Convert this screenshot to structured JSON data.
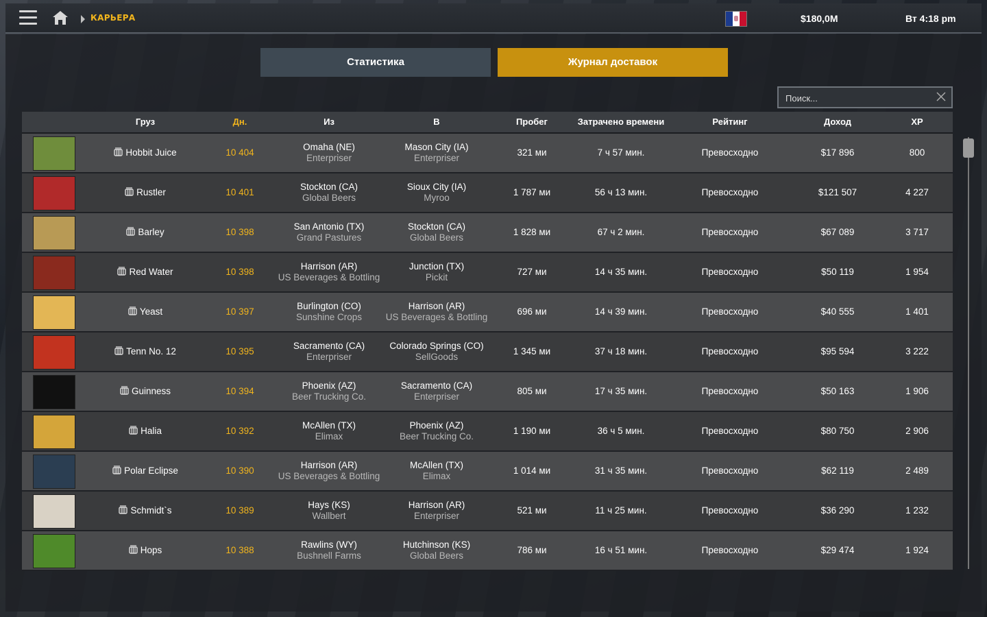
{
  "topbar": {
    "breadcrumb": "КАРЬЕРА",
    "money": "$180,0M",
    "clock": "Вт 4:18 pm"
  },
  "tabs": {
    "stats": "Статистика",
    "log": "Журнал доставок"
  },
  "search": {
    "placeholder": "Поиск..."
  },
  "columns": [
    "Груз",
    "Дн.",
    "Из",
    "В",
    "Пробег",
    "Затрачено времени",
    "Рейтинг",
    "Доход",
    "XP"
  ],
  "rows": [
    {
      "cargo": "Hobbit Juice",
      "days": "10 404",
      "from_city": "Omaha (NE)",
      "from_co": "Enterpriser",
      "to_city": "Mason City (IA)",
      "to_co": "Enterpriser",
      "dist": "321 ми",
      "time": "7 ч 57 мин.",
      "rating": "Превосходно",
      "income": "$17 896",
      "xp": "800",
      "thumb": "#6f8d3c"
    },
    {
      "cargo": "Rustler",
      "days": "10 401",
      "from_city": "Stockton (CA)",
      "from_co": "Global Beers",
      "to_city": "Sioux City (IA)",
      "to_co": "Myroo",
      "dist": "1 787 ми",
      "time": "56 ч 13 мин.",
      "rating": "Превосходно",
      "income": "$121 507",
      "xp": "4 227",
      "thumb": "#b12a2a"
    },
    {
      "cargo": "Barley",
      "days": "10 398",
      "from_city": "San Antonio (TX)",
      "from_co": "Grand Pastures",
      "to_city": "Stockton (CA)",
      "to_co": "Global Beers",
      "dist": "1 828 ми",
      "time": "67 ч 2 мин.",
      "rating": "Превосходно",
      "income": "$67 089",
      "xp": "3 717",
      "thumb": "#b89a55"
    },
    {
      "cargo": "Red Water",
      "days": "10 398",
      "from_city": "Harrison (AR)",
      "from_co": "US Beverages & Bottling",
      "to_city": "Junction (TX)",
      "to_co": "Pickit",
      "dist": "727 ми",
      "time": "14 ч 35 мин.",
      "rating": "Превосходно",
      "income": "$50 119",
      "xp": "1 954",
      "thumb": "#8a2a1e"
    },
    {
      "cargo": "Yeast",
      "days": "10 397",
      "from_city": "Burlington (CO)",
      "from_co": "Sunshine Crops",
      "to_city": "Harrison (AR)",
      "to_co": "US Beverages & Bottling",
      "dist": "696 ми",
      "time": "14 ч 39 мин.",
      "rating": "Превосходно",
      "income": "$40 555",
      "xp": "1 401",
      "thumb": "#e3b655"
    },
    {
      "cargo": "Tenn No. 12",
      "days": "10 395",
      "from_city": "Sacramento (CA)",
      "from_co": "Enterpriser",
      "to_city": "Colorado Springs (CO)",
      "to_co": "SellGoods",
      "dist": "1 345 ми",
      "time": "37 ч 18 мин.",
      "rating": "Превосходно",
      "income": "$95 594",
      "xp": "3 222",
      "thumb": "#c2331f"
    },
    {
      "cargo": "Guinness",
      "days": "10 394",
      "from_city": "Phoenix (AZ)",
      "from_co": "Beer Trucking Co.",
      "to_city": "Sacramento (CA)",
      "to_co": "Enterpriser",
      "dist": "805 ми",
      "time": "17 ч 35 мин.",
      "rating": "Превосходно",
      "income": "$50 163",
      "xp": "1 906",
      "thumb": "#111111"
    },
    {
      "cargo": "Halia",
      "days": "10 392",
      "from_city": "McAllen (TX)",
      "from_co": "Elimax",
      "to_city": "Phoenix (AZ)",
      "to_co": "Beer Trucking Co.",
      "dist": "1 190 ми",
      "time": "36 ч 5 мин.",
      "rating": "Превосходно",
      "income": "$80 750",
      "xp": "2 906",
      "thumb": "#d4a53a"
    },
    {
      "cargo": "Polar Eclipse",
      "days": "10 390",
      "from_city": "Harrison (AR)",
      "from_co": "US Beverages & Bottling",
      "to_city": "McAllen (TX)",
      "to_co": "Elimax",
      "dist": "1 014 ми",
      "time": "31 ч 35 мин.",
      "rating": "Превосходно",
      "income": "$62 119",
      "xp": "2 489",
      "thumb": "#2b3e52"
    },
    {
      "cargo": "Schmidt`s",
      "days": "10 389",
      "from_city": "Hays (KS)",
      "from_co": "Wallbert",
      "to_city": "Harrison (AR)",
      "to_co": "Enterpriser",
      "dist": "521 ми",
      "time": "11 ч 25 мин.",
      "rating": "Превосходно",
      "income": "$36 290",
      "xp": "1 232",
      "thumb": "#d9d2c5"
    },
    {
      "cargo": "Hops",
      "days": "10 388",
      "from_city": "Rawlins (WY)",
      "from_co": "Bushnell Farms",
      "to_city": "Hutchinson (KS)",
      "to_co": "Global Beers",
      "dist": "786 ми",
      "time": "16 ч 51 мин.",
      "rating": "Превосходно",
      "income": "$29 474",
      "xp": "1 924",
      "thumb": "#4f8a2a"
    }
  ]
}
